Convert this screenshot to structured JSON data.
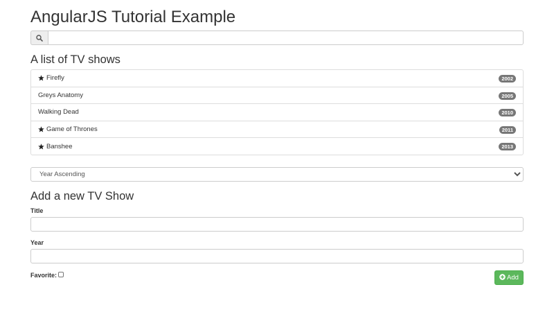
{
  "page_title": "AngularJS Tutorial Example",
  "search": {
    "icon": "search-icon",
    "value": "",
    "placeholder": ""
  },
  "list_heading": "A list of TV shows",
  "shows": [
    {
      "title": "Firefly",
      "year": "2002",
      "favorite": true
    },
    {
      "title": "Greys Anatomy",
      "year": "2005",
      "favorite": false
    },
    {
      "title": "Walking Dead",
      "year": "2010",
      "favorite": false
    },
    {
      "title": "Game of Thrones",
      "year": "2011",
      "favorite": true
    },
    {
      "title": "Banshee",
      "year": "2013",
      "favorite": true
    }
  ],
  "sort": {
    "selected": "Year Ascending"
  },
  "add_form": {
    "heading": "Add a new TV Show",
    "title_label": "Title",
    "title_value": "",
    "year_label": "Year",
    "year_value": "",
    "favorite_label": "Favorite:",
    "favorite_checked": false,
    "add_button_label": "Add",
    "add_button_icon": "plus-circle-icon"
  },
  "colors": {
    "badge": "#777777",
    "add_button": "#5cb85c",
    "border": "#cccccc"
  }
}
